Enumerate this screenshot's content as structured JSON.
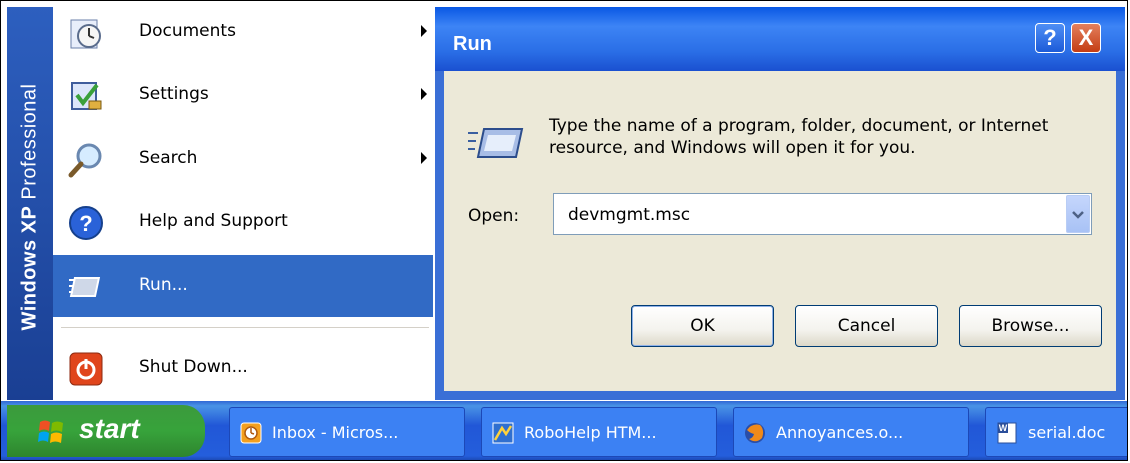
{
  "start_menu": {
    "side_banner": {
      "brand": "Windows XP",
      "edition": "Professional"
    },
    "items": [
      {
        "label": "Documents",
        "has_submenu": true,
        "icon": "documents-icon"
      },
      {
        "label": "Settings",
        "has_submenu": true,
        "icon": "settings-icon"
      },
      {
        "label": "Search",
        "has_submenu": true,
        "icon": "search-icon"
      },
      {
        "label": "Help and Support",
        "has_submenu": false,
        "icon": "help-icon"
      },
      {
        "label": "Run...",
        "has_submenu": false,
        "icon": "run-icon",
        "selected": true
      }
    ],
    "shutdown": {
      "label": "Shut Down...",
      "icon": "power-icon"
    }
  },
  "run_dialog": {
    "title": "Run",
    "help_button": "?",
    "close_button": "X",
    "description": "Type the name of a program, folder, document, or Internet resource, and Windows will open it for you.",
    "open_label": "Open:",
    "open_value": "devmgmt.msc",
    "buttons": {
      "ok": "OK",
      "cancel": "Cancel",
      "browse": "Browse..."
    }
  },
  "taskbar": {
    "start_label": "start",
    "tasks": [
      {
        "label": "Inbox - Micros...",
        "icon": "outlook-icon"
      },
      {
        "label": "RoboHelp HTM...",
        "icon": "robohelp-icon"
      },
      {
        "label": "Annoyances.o...",
        "icon": "firefox-icon"
      },
      {
        "label": "serial.doc",
        "icon": "word-icon"
      }
    ]
  },
  "colors": {
    "selection": "#316ac5",
    "taskbar": "#245edc",
    "start_button": "#37a33b",
    "dialog_titlebar": "#0a58e4"
  }
}
